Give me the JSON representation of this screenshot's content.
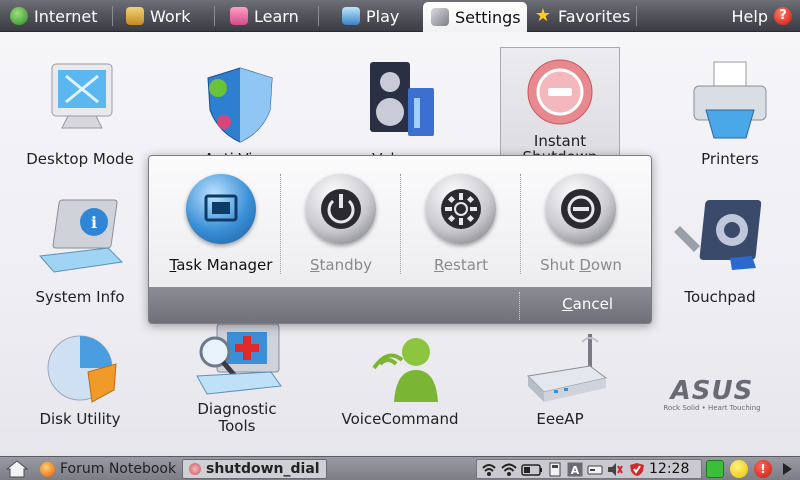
{
  "topbar": {
    "tabs": [
      {
        "label": "Internet",
        "icon": "globe-icon"
      },
      {
        "label": "Work",
        "icon": "briefcase-icon"
      },
      {
        "label": "Learn",
        "icon": "book-icon"
      },
      {
        "label": "Play",
        "icon": "gamepad-icon"
      },
      {
        "label": "Settings",
        "icon": "wrench-icon",
        "active": true
      },
      {
        "label": "Favorites",
        "icon": "star-icon"
      }
    ],
    "help_label": "Help"
  },
  "apps": {
    "desktop_mode": "Desktop Mode",
    "anti_virus": "Anti-Virus",
    "volume": "Volume",
    "instant_shutdown_1": "Instant",
    "instant_shutdown_2": "Shutdown",
    "printers": "Printers",
    "system_info": "System Info",
    "touchpad": "Touchpad",
    "disk_utility": "Disk Utility",
    "diagnostic_tools_1": "Diagnostic",
    "diagnostic_tools_2": "Tools",
    "voice_command": "VoiceCommand",
    "eeeap": "EeeAP"
  },
  "dialog": {
    "task_manager": {
      "mnemonic": "T",
      "rest": "ask Manager"
    },
    "standby": {
      "mnemonic": "S",
      "rest": "tandby"
    },
    "restart": {
      "mnemonic": "R",
      "rest": "estart"
    },
    "shutdown": {
      "pre": "Shut ",
      "mnemonic": "D",
      "rest": "own"
    },
    "cancel": {
      "mnemonic": "C",
      "rest": "ancel"
    }
  },
  "taskbar": {
    "items": [
      {
        "label": "Forum Notebook",
        "icon": "firefox-icon"
      },
      {
        "label": "shutdown_dial",
        "icon": "app-icon",
        "active": true
      }
    ],
    "clock": "12:28"
  },
  "watermark": {
    "brand": "ASUS",
    "tagline": "Rock Solid • Heart Touching"
  },
  "colors": {
    "accent": "#3a8fd6",
    "topbar": "#4a4a52",
    "danger": "#d12a2a"
  }
}
